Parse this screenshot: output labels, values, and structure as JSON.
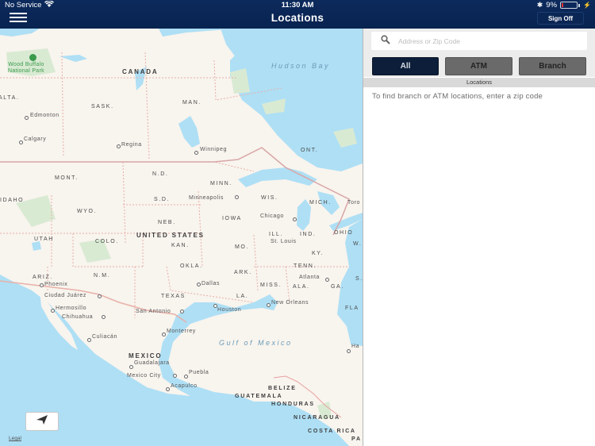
{
  "status_bar": {
    "carrier": "No Service",
    "time": "11:30 AM",
    "battery_percent_text": "9%",
    "battery_level": 0.09,
    "icons": [
      "wifi-icon",
      "bluetooth-icon",
      "battery-icon",
      "charging-icon"
    ]
  },
  "header": {
    "title": "Locations",
    "menu_icon": "hamburger-menu-icon",
    "sign_off_label": "Sign Off"
  },
  "map": {
    "labels": {
      "hudson_bay": "Hudson Bay",
      "wood_buffalo": "Wood Buffalo\nNational Park",
      "canada": "CANADA",
      "alta": "ALTA.",
      "sask": "SASK.",
      "man": "MAN.",
      "ont": "ONT.",
      "mont": "MONT.",
      "nd": "N.D.",
      "minn": "MINN.",
      "idaho": "IDAHO",
      "sd": "S.D.",
      "wis": "WIS.",
      "mich": "MICH.",
      "wyo": "WYO.",
      "iowa": "IOWA",
      "neb": "NEB.",
      "united_states": "UNITED STATES",
      "ill": "ILL.",
      "ind": "IND.",
      "ohio": "OHIO",
      "utah": "UTAH",
      "colo": "COLO.",
      "kan": "KAN.",
      "mo": "MO.",
      "ky": "KY.",
      "w": "W.",
      "okla": "OKLA.",
      "tenn": "TENN.",
      "ariz": "ARIZ.",
      "nm": "N.M.",
      "ark": "ARK.",
      "miss": "MISS.",
      "ala": "ALA.",
      "ga": "GA.",
      "s": "S.",
      "texas": "TEXAS",
      "la": "LA.",
      "fla": "FLA",
      "gulf": "Gulf of Mexico",
      "mexico": "MEXICO",
      "belize": "BELIZE",
      "guatemala": "GUATEMALA",
      "honduras": "HONDURAS",
      "nicaragua": "NICARAGUA",
      "costa_rica": "COSTA RICA",
      "pa": "PA"
    },
    "cities": {
      "edmonton": "Edmonton",
      "calgary": "Calgary",
      "regina": "Regina",
      "winnipeg": "Winnipeg",
      "minneapolis": "Minneapolis",
      "chicago": "Chicago",
      "toronto": "Toro",
      "st_louis": "St. Louis",
      "phoenix": "Phoenix",
      "dallas": "Dallas",
      "atlanta": "Atlanta",
      "ciudad_juarez": "Ciudad Juárez",
      "hermosillo": "Hermosillo",
      "chihuahua": "Chihuahua",
      "san_antonio": "San Antonio",
      "houston": "Houston",
      "new_orleans": "New Orleans",
      "monterrey": "Monterrey",
      "culiacan": "Culiacán",
      "havana": "Ha",
      "guadalajara": "Guadalajara",
      "mexico_city": "Mexico City",
      "puebla": "Puebla",
      "acapulco": "Acapulco"
    },
    "locate_icon": "location-arrow-icon",
    "legal_label": "Legal"
  },
  "panel": {
    "search": {
      "placeholder": "Address or Zip Code",
      "value": "",
      "icon": "search-icon"
    },
    "filters": [
      {
        "label": "All",
        "selected": true
      },
      {
        "label": "ATM",
        "selected": false
      },
      {
        "label": "Branch",
        "selected": false
      }
    ],
    "section_header": "Locations",
    "hint": "To find branch or ATM locations, enter a zip code"
  }
}
